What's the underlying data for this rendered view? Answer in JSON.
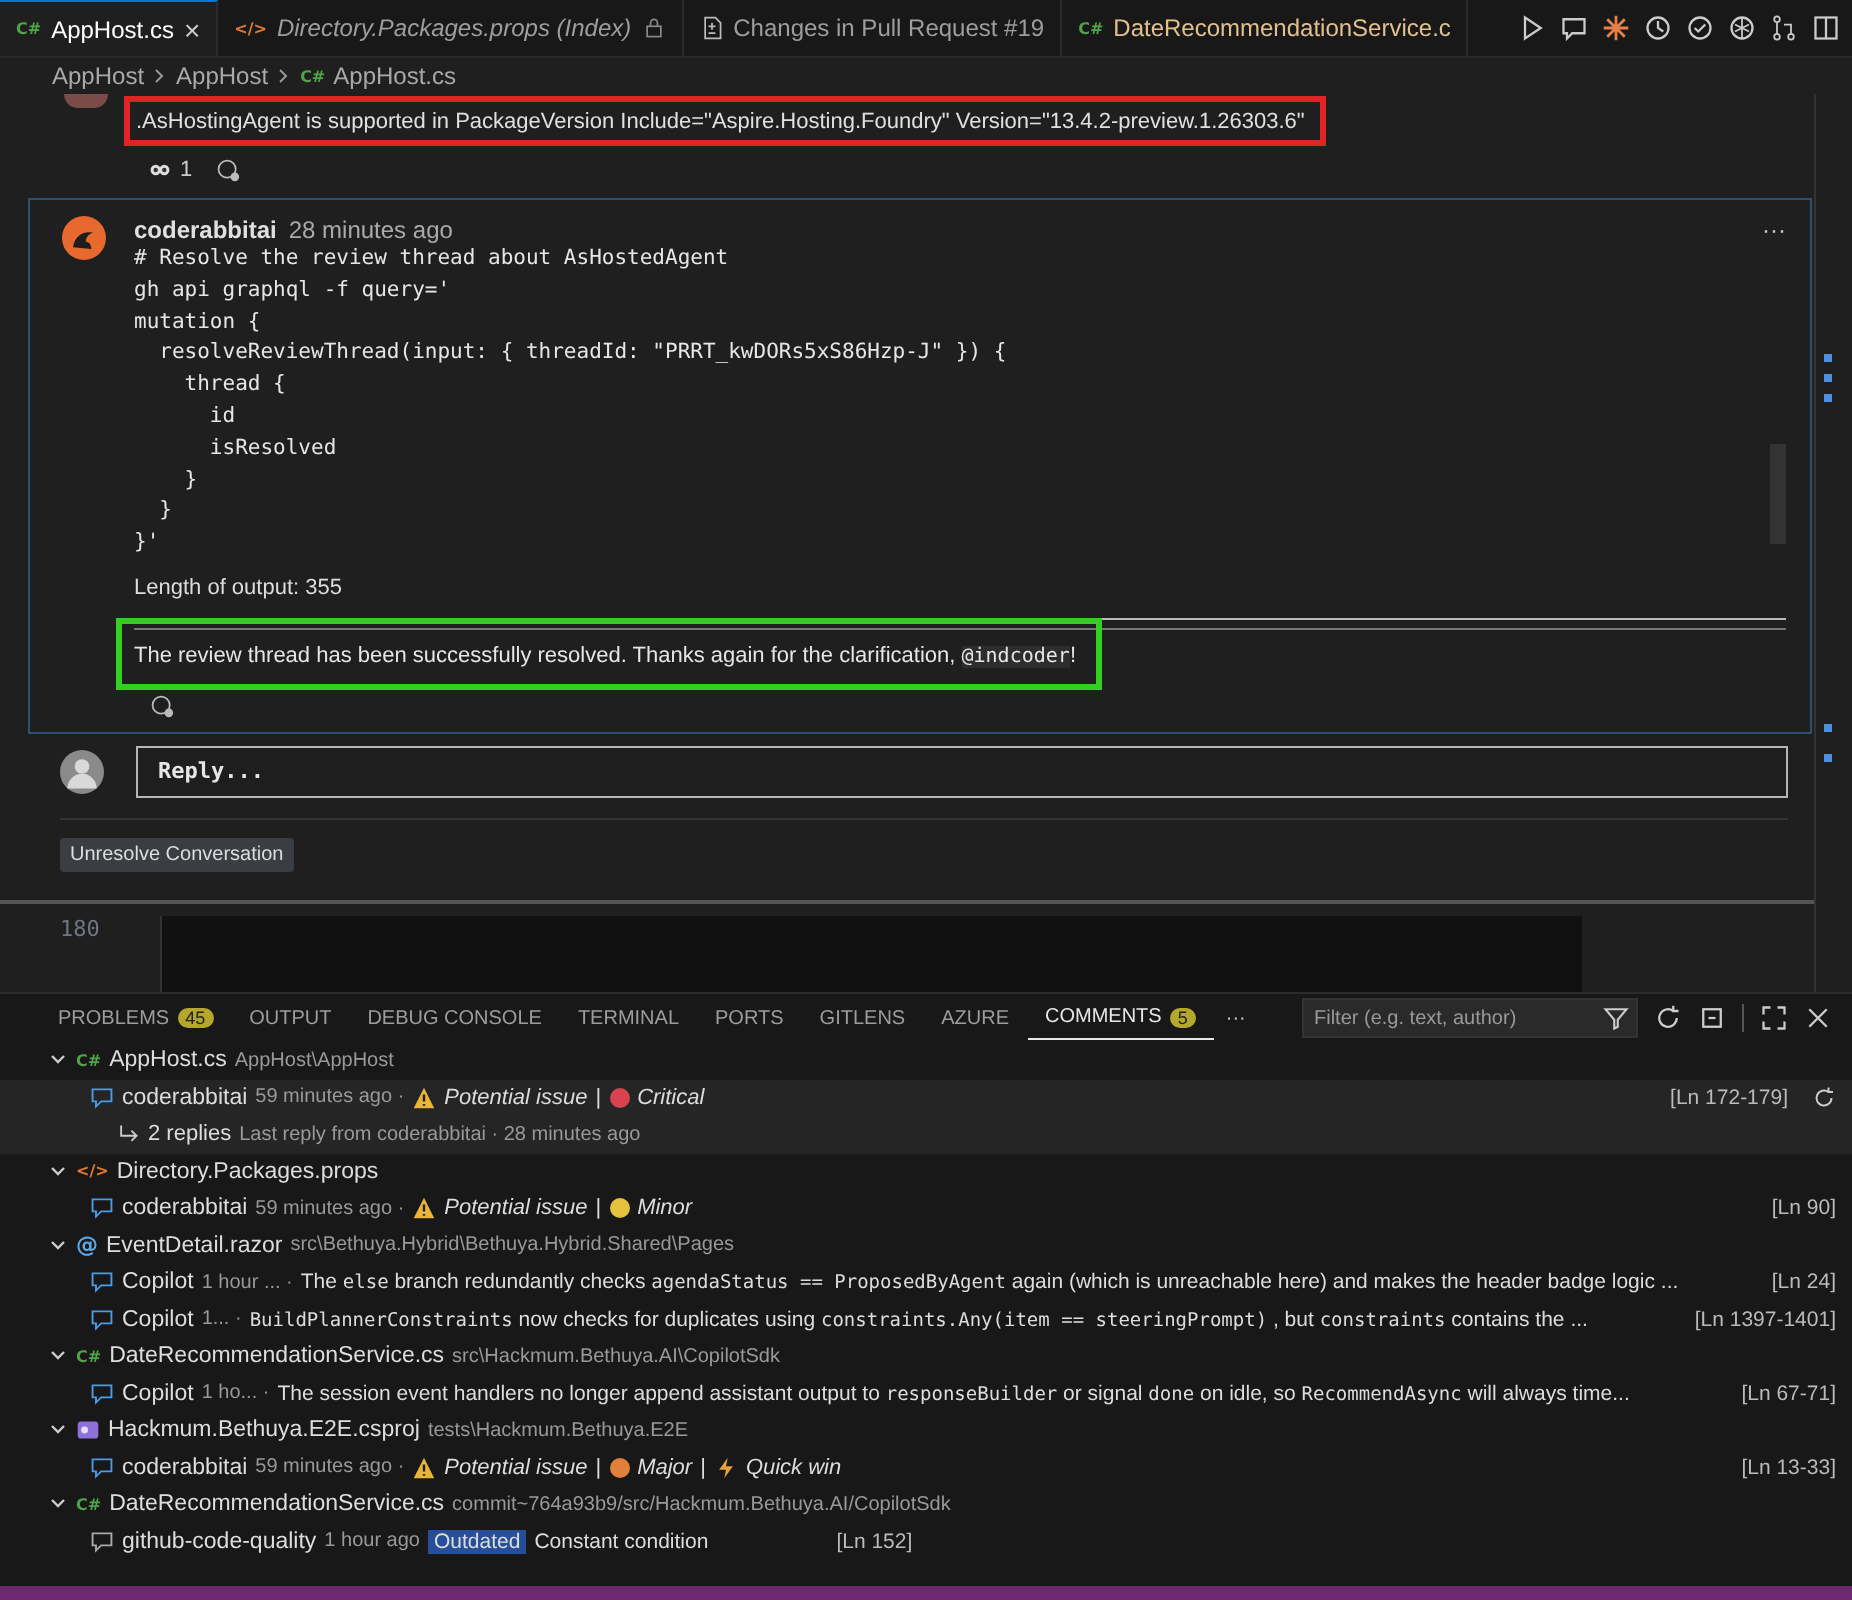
{
  "tabs": [
    {
      "kind": "csharp",
      "glyph": "C#",
      "label": "AppHost.cs",
      "selected": true,
      "preview": false,
      "close": "×"
    },
    {
      "kind": "xml",
      "glyph": "</>",
      "label": "Directory.Packages.props (Index)",
      "selected": false,
      "preview": true
    },
    {
      "kind": "diff",
      "label": "Changes in Pull Request #19",
      "selected": false,
      "preview": false
    },
    {
      "kind": "csharp",
      "glyph": "C#",
      "label": "DateRecommendationService.c",
      "selected": false,
      "preview": false
    }
  ],
  "breadcrumb": [
    {
      "label": "AppHost"
    },
    {
      "label": "AppHost"
    },
    {
      "glyph": "C#",
      "label": "AppHost.cs"
    }
  ],
  "first_comment": {
    "text": ".AsHostingAgent is supported in PackageVersion Include=\"Aspire.Hosting.Foundry\" Version=\"13.4.2-preview.1.26303.6\"",
    "reaction_count": "1"
  },
  "second_comment": {
    "author": "coderabbitai",
    "time": "28 minutes ago",
    "more": "···",
    "code": [
      "# Resolve the review thread about AsHostedAgent",
      "gh api graphql -f query='",
      "mutation {",
      "  resolveReviewThread(input: { threadId: \"PRRT_kwDORs5xS86Hzp-J\" }) {",
      "    thread {",
      "      id",
      "      isResolved",
      "    }",
      "  }",
      "}'"
    ],
    "output": "Length of output: 355",
    "message": "The review thread has been successfully resolved. Thanks again for the clarification, ",
    "mention": "@indcoder",
    "message_end": "!"
  },
  "reply": {
    "placeholder": "Reply..."
  },
  "unresolve_button": "Unresolve Conversation",
  "editor": {
    "line_number": "180"
  },
  "panel_tabs": [
    {
      "label": "PROBLEMS",
      "badge": "45",
      "selected": false
    },
    {
      "label": "OUTPUT",
      "selected": false
    },
    {
      "label": "DEBUG CONSOLE",
      "selected": false
    },
    {
      "label": "TERMINAL",
      "selected": false
    },
    {
      "label": "PORTS",
      "selected": false
    },
    {
      "label": "GITLENS",
      "selected": false
    },
    {
      "label": "AZURE",
      "selected": false
    },
    {
      "label": "COMMENTS",
      "badge": "5",
      "selected": true
    }
  ],
  "panel_more": "···",
  "filter": {
    "placeholder": "Filter (e.g. text, author)"
  },
  "files": [
    {
      "kind": "csharp",
      "glyph": "C#",
      "name": "AppHost.cs",
      "path": "AppHost\\AppHost",
      "expanded": true,
      "comments": [
        {
          "author": "coderabbitai",
          "time": "59 minutes ago ·",
          "selected": true,
          "tags": [
            {
              "kind": "warning",
              "text": "Potential issue"
            },
            {
              "kind": "severity",
              "sep": "|",
              "color": "#d9434d",
              "text": "Critical"
            }
          ],
          "lines": "[Ln 172-179]",
          "replies": {
            "count": "2 replies",
            "last": "Last reply from coderabbitai · 28 minutes ago"
          }
        }
      ]
    },
    {
      "kind": "xml",
      "glyph": "</>",
      "name": "Directory.Packages.props",
      "expanded": true,
      "comments": [
        {
          "author": "coderabbitai",
          "time": "59 minutes ago ·",
          "selected": false,
          "tags": [
            {
              "kind": "warning",
              "text": "Potential issue"
            },
            {
              "kind": "severity",
              "sep": "|",
              "color": "#e5c13d",
              "text": "Minor"
            }
          ],
          "lines": "[Ln 90]"
        }
      ]
    },
    {
      "kind": "razor",
      "glyph": "@",
      "name": "EventDetail.razor",
      "path": "src\\Bethuya.Hybrid\\Bethuya.Hybrid.Shared\\Pages",
      "expanded": true,
      "comments": [
        {
          "author": "Copilot",
          "time": "1 hour ... ·",
          "selected": false,
          "segments": [
            {
              "t": "The ",
              "code": false
            },
            {
              "t": "else",
              "code": true
            },
            {
              "t": " branch redundantly checks ",
              "code": false
            },
            {
              "t": "agendaStatus == ProposedByAgent",
              "code": true
            },
            {
              "t": " again (which is unreachable here) and makes the header badge logic ...",
              "code": false
            }
          ],
          "lines": "[Ln 24]"
        },
        {
          "author": "Copilot",
          "time": "1... ·",
          "selected": false,
          "segments": [
            {
              "t": "BuildPlannerConstraints",
              "code": true
            },
            {
              "t": " now checks for duplicates using ",
              "code": false
            },
            {
              "t": "constraints.Any(item == steeringPrompt)",
              "code": true
            },
            {
              "t": " , but ",
              "code": false
            },
            {
              "t": "constraints",
              "code": true
            },
            {
              "t": " contains the ...",
              "code": false
            }
          ],
          "lines": "[Ln 1397-1401]"
        }
      ]
    },
    {
      "kind": "csharp",
      "glyph": "C#",
      "name": "DateRecommendationService.cs",
      "path": "src\\Hackmum.Bethuya.AI\\CopilotSdk",
      "expanded": true,
      "comments": [
        {
          "author": "Copilot",
          "time": "1 ho... ·",
          "selected": false,
          "segments": [
            {
              "t": "The session event handlers no longer append assistant output to ",
              "code": false
            },
            {
              "t": "responseBuilder",
              "code": true
            },
            {
              "t": " or signal ",
              "code": false
            },
            {
              "t": "done",
              "code": true
            },
            {
              "t": " on idle, so ",
              "code": false
            },
            {
              "t": "RecommendAsync",
              "code": true
            },
            {
              "t": " will always time...",
              "code": false
            }
          ],
          "lines": "[Ln 67-71]"
        }
      ]
    },
    {
      "kind": "project",
      "name": "Hackmum.Bethuya.E2E.csproj",
      "path": "tests\\Hackmum.Bethuya.E2E",
      "expanded": true,
      "comments": [
        {
          "author": "coderabbitai",
          "time": "59 minutes ago ·",
          "selected": false,
          "tags": [
            {
              "kind": "warning",
              "text": "Potential issue"
            },
            {
              "kind": "severity",
              "sep": "|",
              "color": "#e0803a",
              "text": "Major"
            },
            {
              "kind": "quick",
              "sep": "|",
              "text": "Quick win"
            }
          ],
          "lines": "[Ln 13-33]"
        }
      ]
    },
    {
      "kind": "csharp",
      "glyph": "C#",
      "name": "DateRecommendationService.cs",
      "path": "commit~764a93b9/src/Hackmum.Bethuya.AI/CopilotSdk",
      "expanded": true,
      "comments": [
        {
          "author": "github-code-quality",
          "time": "1 hour ago",
          "selected": false,
          "badge": "Outdated",
          "segments": [
            {
              "t": "Constant condition",
              "code": false
            }
          ],
          "lines": "[Ln 152]"
        }
      ]
    }
  ]
}
